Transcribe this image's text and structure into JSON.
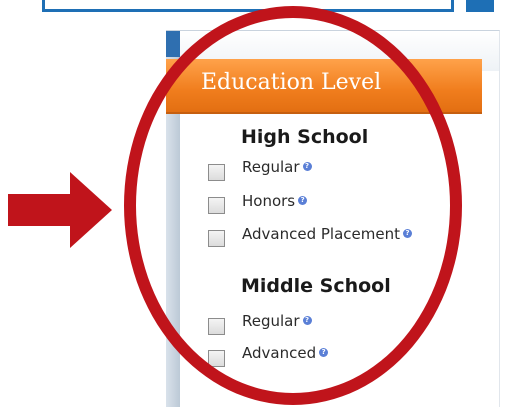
{
  "panel": {
    "tab_label": "Education Level"
  },
  "sections": [
    {
      "title": "High School",
      "options": [
        {
          "label": "Regular",
          "checked": false,
          "help_icon": "question-icon"
        },
        {
          "label": "Honors",
          "checked": false,
          "help_icon": "question-icon"
        },
        {
          "label": "Advanced Placement",
          "checked": false,
          "help_icon": "question-icon"
        }
      ]
    },
    {
      "title": "Middle School",
      "options": [
        {
          "label": "Regular",
          "checked": false,
          "help_icon": "question-icon"
        },
        {
          "label": "Advanced",
          "checked": false,
          "help_icon": "question-icon"
        }
      ]
    }
  ],
  "annotations": {
    "arrow_color": "#c0141b",
    "circle_color": "#c0141b",
    "tab_color": "#f07d1d",
    "accent_blue": "#1e6fb5"
  }
}
